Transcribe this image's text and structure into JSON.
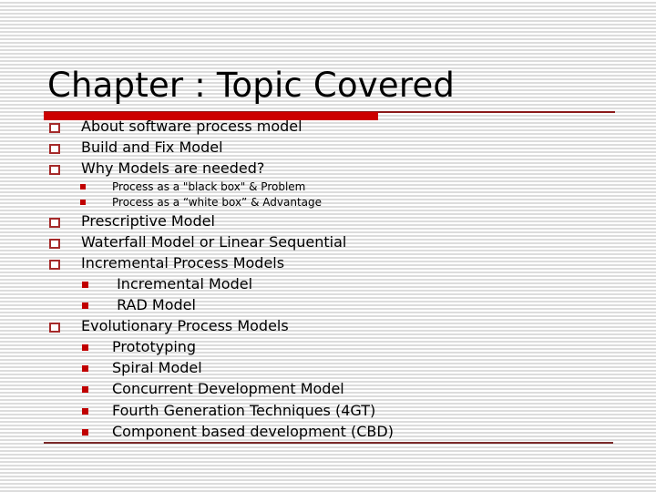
{
  "slide": {
    "title": "Chapter : Topic Covered",
    "accent_color": "#cc0000",
    "items": [
      {
        "level": 1,
        "text": "About software process model"
      },
      {
        "level": 1,
        "text": "Build and Fix Model"
      },
      {
        "level": 1,
        "text": "Why Models are needed?"
      },
      {
        "level": 2,
        "size": "small",
        "text": "Process as a \"black box\" & Problem"
      },
      {
        "level": 2,
        "size": "small",
        "text": "Process as a “white box” & Advantage"
      },
      {
        "level": 1,
        "text": "Prescriptive Model"
      },
      {
        "level": 1,
        "text": "Waterfall Model or Linear Sequential"
      },
      {
        "level": 1,
        "text": "Incremental Process Models"
      },
      {
        "level": 2,
        "text": " Incremental Model"
      },
      {
        "level": 2,
        "text": " RAD Model"
      },
      {
        "level": 1,
        "text": "Evolutionary Process Models"
      },
      {
        "level": 2,
        "text": "Prototyping"
      },
      {
        "level": 2,
        "text": "Spiral Model"
      },
      {
        "level": 2,
        "text": "Concurrent Development Model"
      },
      {
        "level": 2,
        "text": "Fourth Generation Techniques (4GT)"
      },
      {
        "level": 2,
        "text": "Component based development (CBD)"
      }
    ]
  }
}
